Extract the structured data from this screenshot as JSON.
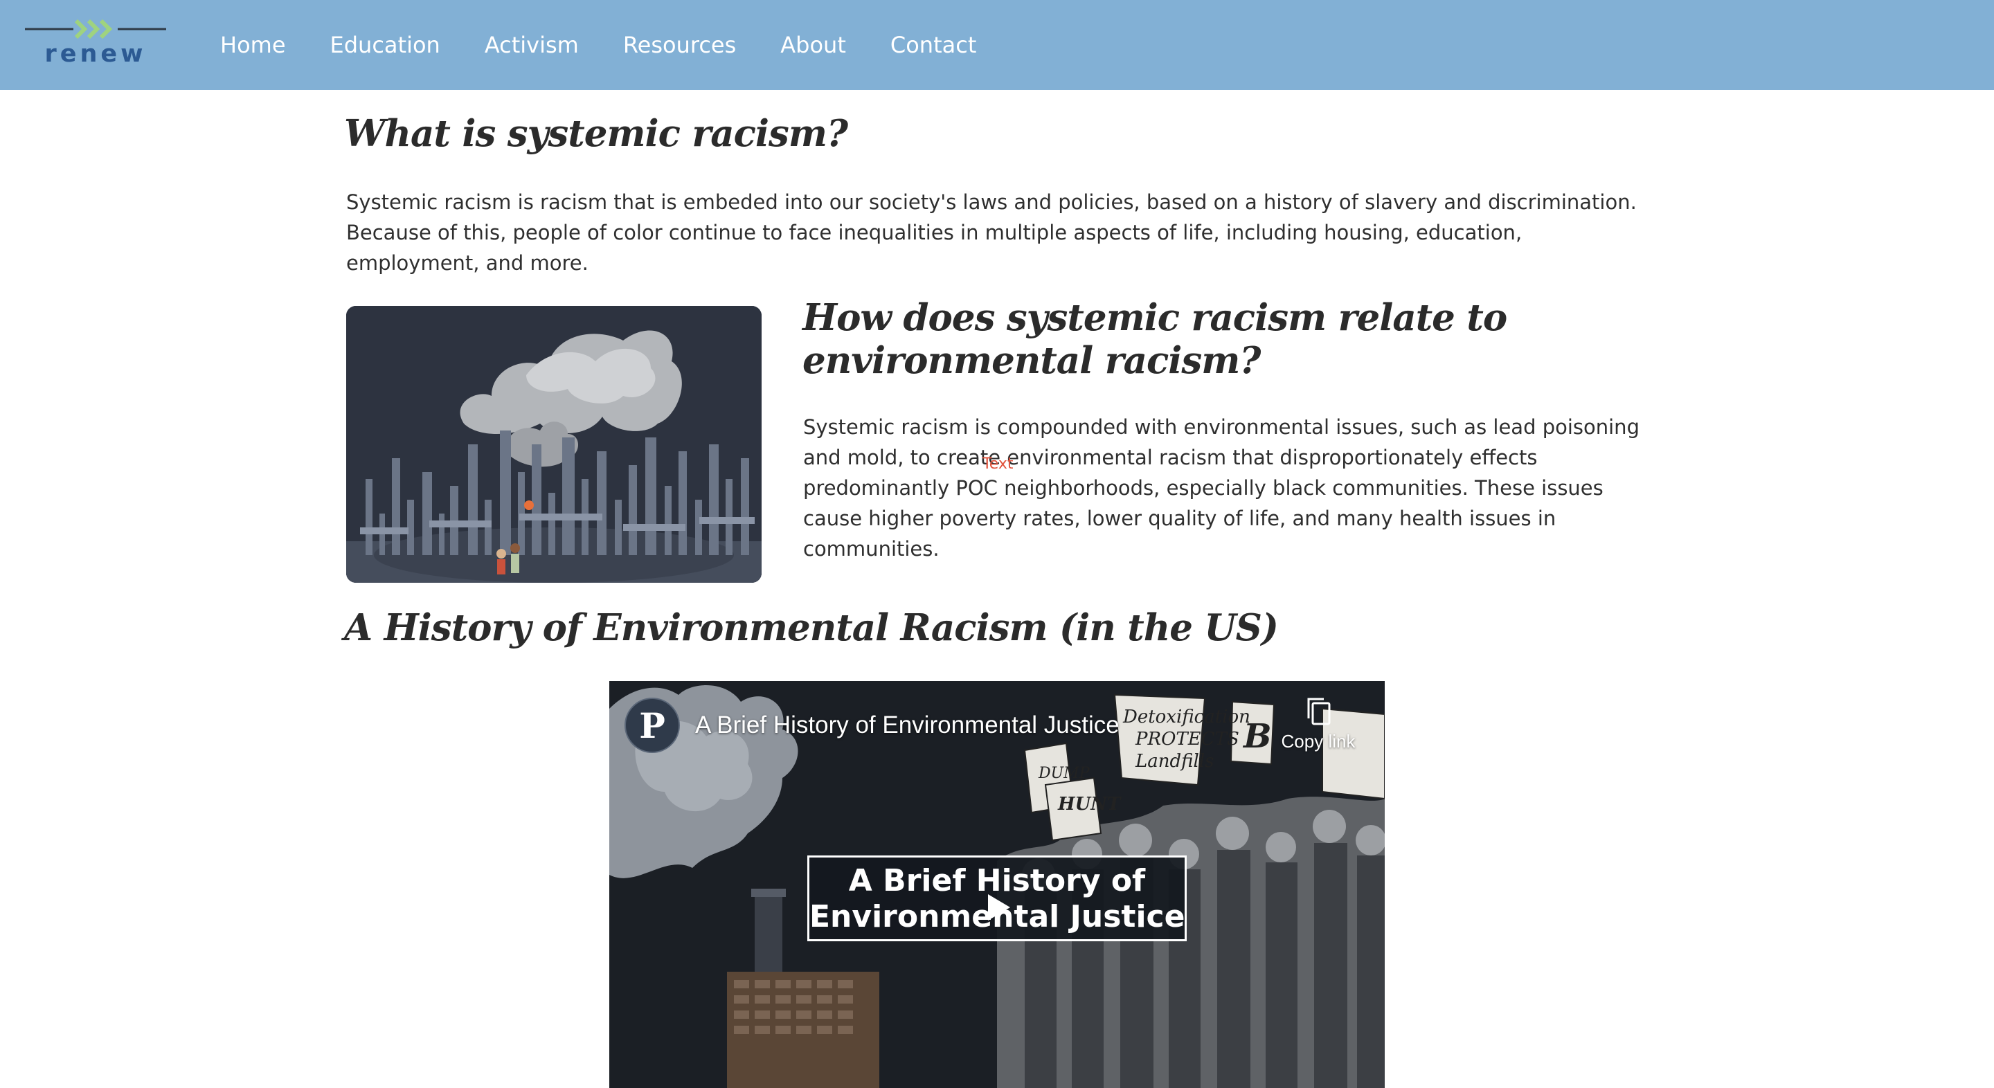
{
  "header": {
    "logo_text": "renew",
    "nav": [
      "Home",
      "Education",
      "Activism",
      "Resources",
      "About",
      "Contact"
    ]
  },
  "sections": {
    "systemic": {
      "title": "What is systemic racism?",
      "body": "Systemic racism is racism that is embeded into our society's laws and policies, based on a history of slavery and discrimination. Because of this, people of color continue to face inequalities in multiple aspects of life, including housing, education, employment, and more."
    },
    "relate": {
      "title": "How does systemic racism relate to environmental racism?",
      "body": "Systemic racism is compounded with environmental issues, such as lead poisoning and mold, to create environmental racism that disproportionately effects predominantly POC neighborhoods, especially black communities. These issues cause higher poverty rates, lower quality of life, and many health issues in communities.",
      "overlay_label": "Text"
    },
    "history": {
      "title": "A History of Environmental Racism (in the US)"
    }
  },
  "video": {
    "channel_initial": "P",
    "title": "A Brief History of Environmental Justice",
    "copy_link_label": "Copy link",
    "title_card_line1": "A Brief History of",
    "title_card_line2": "Environmental Justice"
  },
  "colors": {
    "header_bg": "#82b0d5",
    "logo_chevrons": "#9fd37f",
    "logo_text": "#2c5a93",
    "overlay_text": "#e0533d"
  },
  "icons": {
    "logo": "chevrons-logo-icon",
    "copy": "copy-icon",
    "play": "play-icon"
  }
}
